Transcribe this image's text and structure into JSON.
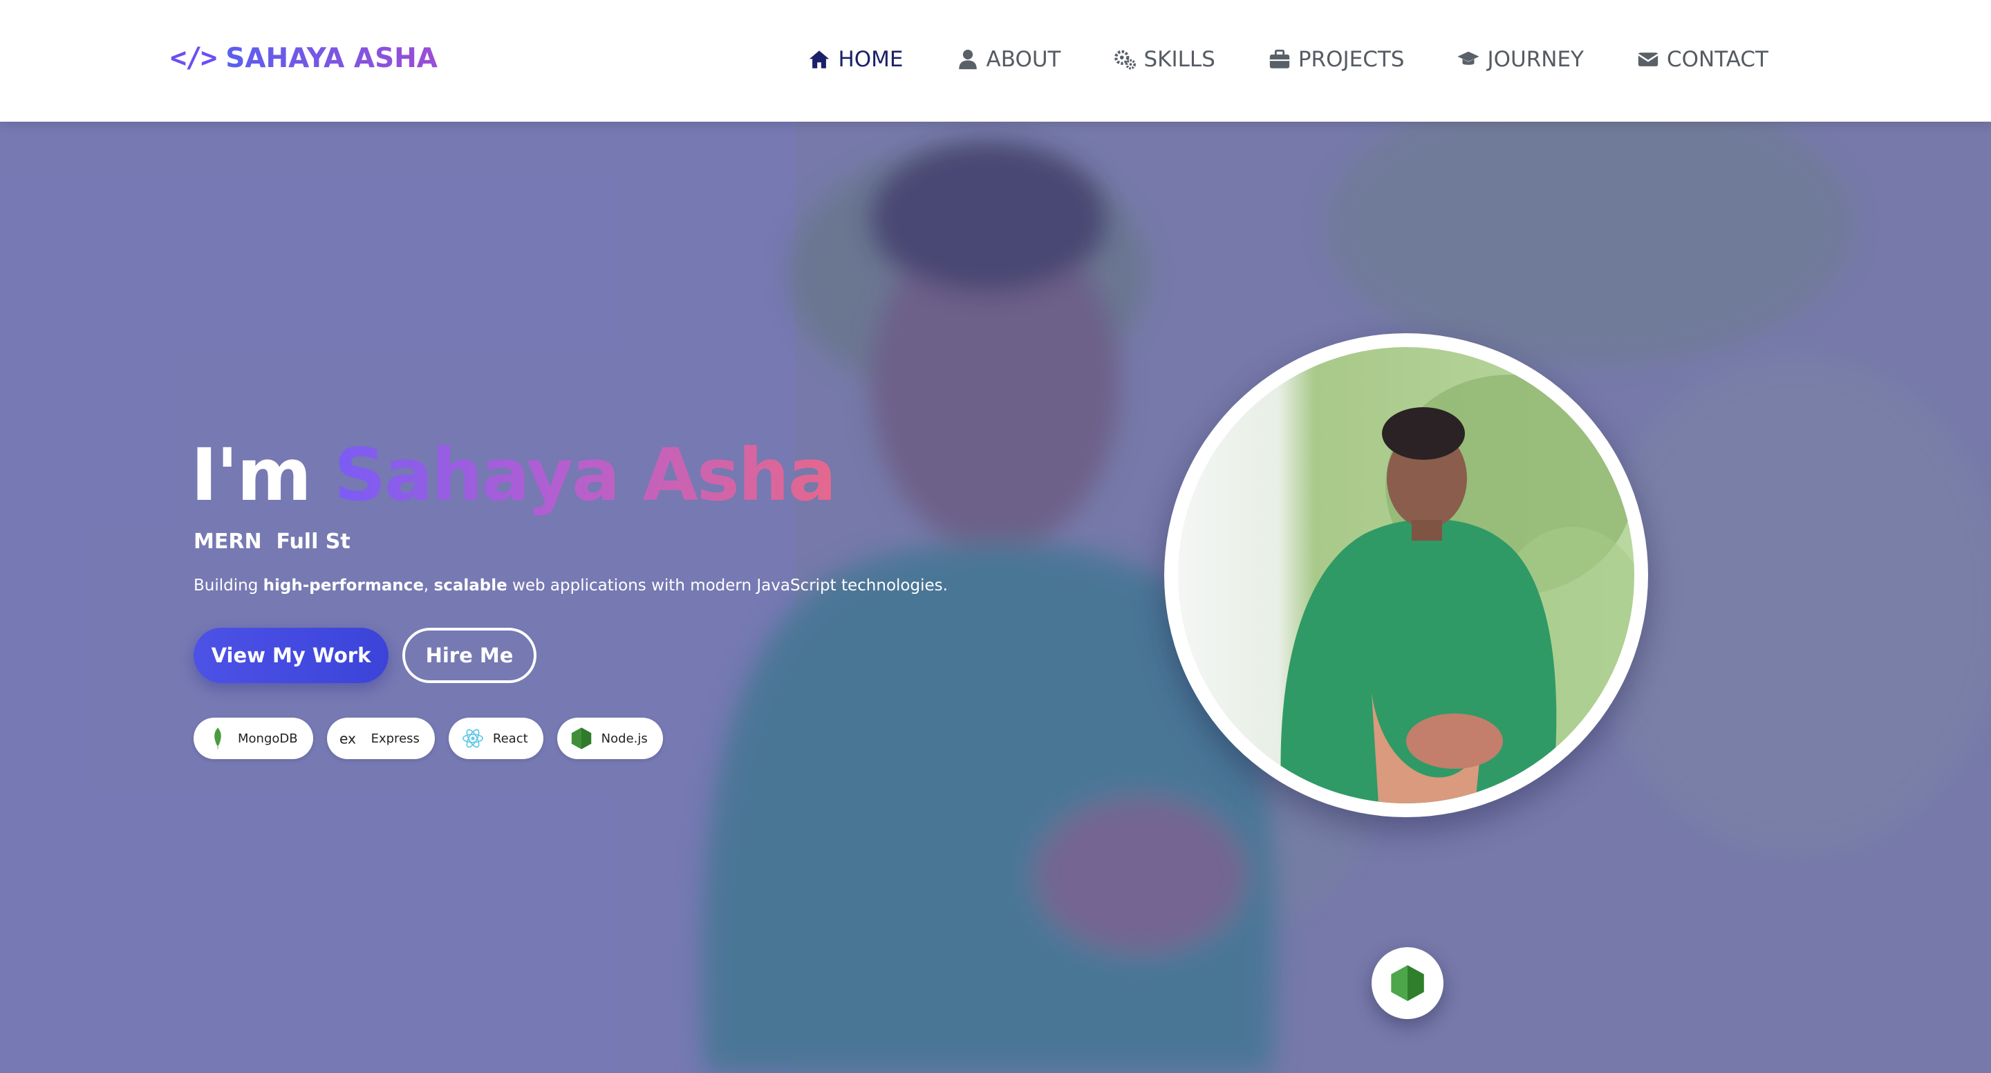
{
  "brand": {
    "logo_symbol": "</>",
    "name": "SAHAYA ASHA",
    "accent": "#6c4df6"
  },
  "nav": {
    "items": [
      {
        "label": "HOME",
        "icon": "home-icon",
        "active": true
      },
      {
        "label": "ABOUT",
        "icon": "user-icon",
        "active": false
      },
      {
        "label": "SKILLS",
        "icon": "gears-icon",
        "active": false
      },
      {
        "label": "PROJECTS",
        "icon": "briefcase-icon",
        "active": false
      },
      {
        "label": "JOURNEY",
        "icon": "graduation-cap-icon",
        "active": false
      },
      {
        "label": "CONTACT",
        "icon": "envelope-icon",
        "active": false
      }
    ]
  },
  "hero": {
    "greeting": "I'm",
    "name": "Sahaya Asha",
    "role": "MERN  Full St",
    "description": {
      "prefix": "Building ",
      "bold1": "high-performance",
      "sep": ", ",
      "bold2": "scalable",
      "suffix": " web applications with modern JavaScript technologies."
    },
    "primary_button": "View My Work",
    "secondary_button": "Hire Me",
    "tech_stack": [
      {
        "label": "MongoDB",
        "icon": "mongodb-icon"
      },
      {
        "label": "Express",
        "icon": "express-icon"
      },
      {
        "label": "React",
        "icon": "react-icon"
      },
      {
        "label": "Node.js",
        "icon": "nodejs-icon"
      }
    ],
    "floating_icon": "nodejs-icon"
  },
  "colors": {
    "nav_active": "#1b2168",
    "nav_text": "#555b63",
    "button_primary": "#4d52e6",
    "name_gradient": [
      "#7a5cf5",
      "#b45fd0",
      "#e5688d"
    ],
    "hero_overlay": "#6262aa"
  }
}
